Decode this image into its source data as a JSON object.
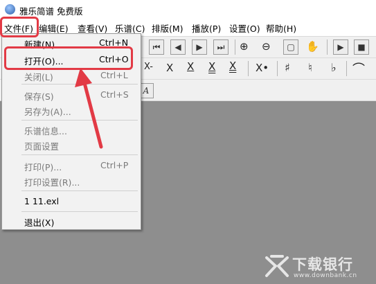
{
  "window": {
    "title": "雅乐简谱 免费版"
  },
  "menubar": [
    "文件(F)",
    "编辑(E)",
    "查看(V)",
    "乐谱(C)",
    "排版(M)",
    "播放(P)",
    "设置(O)",
    "帮助(H)"
  ],
  "file_menu": {
    "new": {
      "label": "新建(N)",
      "shortcut": "Ctrl+N"
    },
    "open": {
      "label": "打开(O)...",
      "shortcut": "Ctrl+O"
    },
    "close": {
      "label": "关闭(L)",
      "shortcut": "Ctrl+L"
    },
    "save": {
      "label": "保存(S)",
      "shortcut": "Ctrl+S"
    },
    "save_as": {
      "label": "另存为(A)..."
    },
    "score_info": {
      "label": "乐谱信息..."
    },
    "page_setup": {
      "label": "页面设置"
    },
    "print": {
      "label": "打印(P)...",
      "shortcut": "Ctrl+P"
    },
    "print_setup": {
      "label": "打印设置(R)..."
    },
    "recent": {
      "label": "1 11.exl"
    },
    "exit": {
      "label": "退出(X)"
    }
  },
  "toolbar": {
    "row2_symbols": [
      "X-",
      "X",
      "X",
      "X",
      "X",
      "X•",
      "♯",
      "♮",
      "♭",
      "⌒"
    ],
    "row3_symbols": [
      "A"
    ]
  },
  "watermark": {
    "text": "下载银行",
    "url": "www.downbank.cn"
  },
  "colors": {
    "highlight": "#e23a45",
    "canvas": "#8e8e8e"
  }
}
